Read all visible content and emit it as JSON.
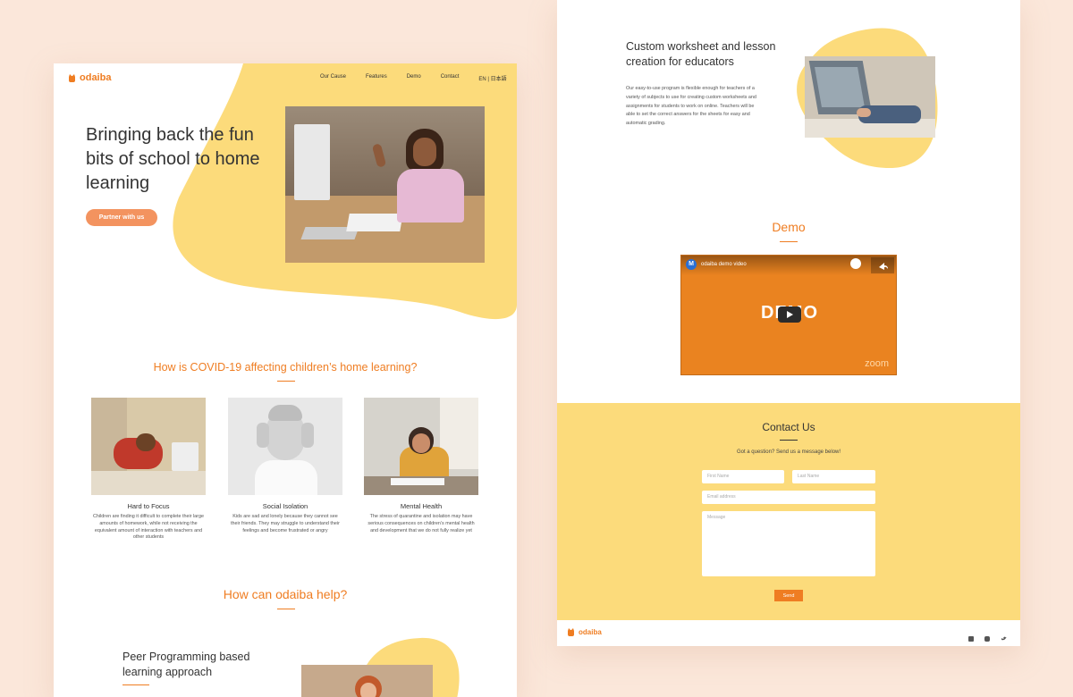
{
  "brand": {
    "name": "odaiba",
    "accent": "#ef7d22",
    "yellow": "#fcdb7b",
    "background": "#fbe7da"
  },
  "nav": {
    "items": [
      "Our Cause",
      "Features",
      "Demo",
      "Contact"
    ],
    "lang": "EN | 日本語"
  },
  "hero": {
    "title": "Bringing back the fun bits of school to home learning",
    "cta": "Partner with us"
  },
  "covid": {
    "title": "How is COVID-19 affecting children’s home learning?",
    "cards": [
      {
        "title": "Hard to Focus",
        "text": "Children are finding it difficult to complete their large amounts of homework, while not receiving the equivalent amount of interaction with teachers and other students"
      },
      {
        "title": "Social Isolation",
        "text": "Kids are sad and lonely because they cannot see their friends. They may struggle to understand their feelings and become frustrated or angry"
      },
      {
        "title": "Mental Health",
        "text": "The stress of quarantine and isolation may have serious consequences on children’s mental health and development that we do not fully realize yet"
      }
    ]
  },
  "help": {
    "title": "How can odaiba help?",
    "feature_title": "Peer Programming based learning approach"
  },
  "worksheet": {
    "title": "Custom worksheet and lesson creation for educators",
    "text": "Our easy-to-use program is flexible enough for teachers of a variety of subjects to use for creating custom worksheets and assignments for students to work on online. Teachers will be able to set the correct answers for the sheets for easy and automatic grading."
  },
  "demo": {
    "title": "Demo",
    "video_title": "odaiba demo video",
    "video_avatar": "M",
    "video_big": "DEMO",
    "video_brand": "zoom"
  },
  "contact": {
    "title": "Contact Us",
    "subtitle": "Got a question? Send us a message below!",
    "first_name": "First Name",
    "last_name": "Last Name",
    "email": "Email address",
    "message": "Message",
    "send": "Send"
  },
  "footer": {
    "icons": [
      "facebook-icon",
      "instagram-icon",
      "twitter-icon"
    ]
  }
}
